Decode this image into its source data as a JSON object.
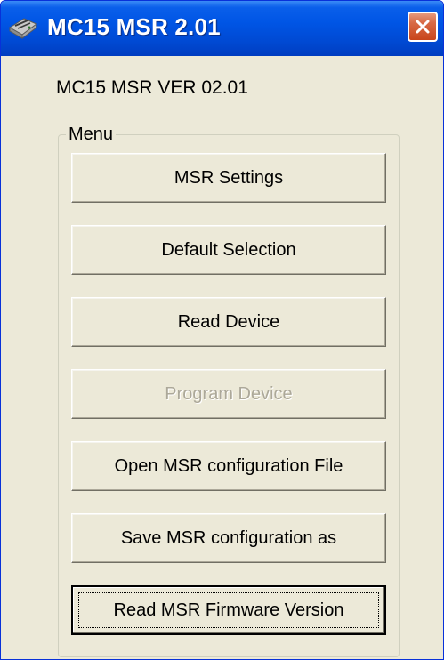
{
  "window": {
    "title": "MC15 MSR 2.01",
    "app_icon": "device-icon",
    "close_icon": "close-icon",
    "colors": {
      "titlebar": "#0055e5",
      "close": "#c8451c",
      "body": "#ece9d8"
    }
  },
  "version_label": "MC15 MSR VER 02.01",
  "menu": {
    "legend": "Menu",
    "buttons": [
      {
        "label": "MSR Settings",
        "enabled": true
      },
      {
        "label": "Default Selection",
        "enabled": true
      },
      {
        "label": "Read Device",
        "enabled": true
      },
      {
        "label": "Program Device",
        "enabled": false
      },
      {
        "label": "Open MSR configuration File",
        "enabled": true
      },
      {
        "label": "Save MSR configuration as",
        "enabled": true
      },
      {
        "label": "Read MSR Firmware Version",
        "enabled": true,
        "focused": true
      }
    ]
  }
}
